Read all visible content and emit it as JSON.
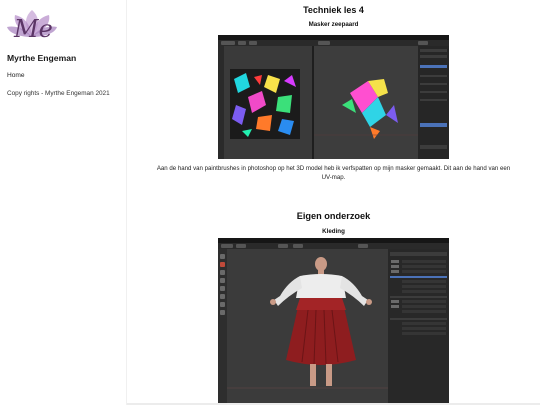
{
  "sidebar": {
    "logo_text": "Me",
    "site_title": "Myrthe Engeman",
    "nav": {
      "home": "Home"
    },
    "copyright": "Copy rights - Myrthe Engeman 2021"
  },
  "section1": {
    "title": "Techniek les 4",
    "subtitle": "Masker zeepaard",
    "caption": "Aan de hand van paintbrushes in photoshop op het 3D model heb ik verfspatten op mijn masker gemaakt. Dit aan de hand van een UV-map."
  },
  "section2": {
    "title": "Eigen onderzoek",
    "subtitle": "Kleding"
  },
  "colors": {
    "logo_purple": "#8a5a9a",
    "blender_bg": "#3a3a3a",
    "skirt_red": "#8e1d1f",
    "shirt_white": "#ececec"
  }
}
